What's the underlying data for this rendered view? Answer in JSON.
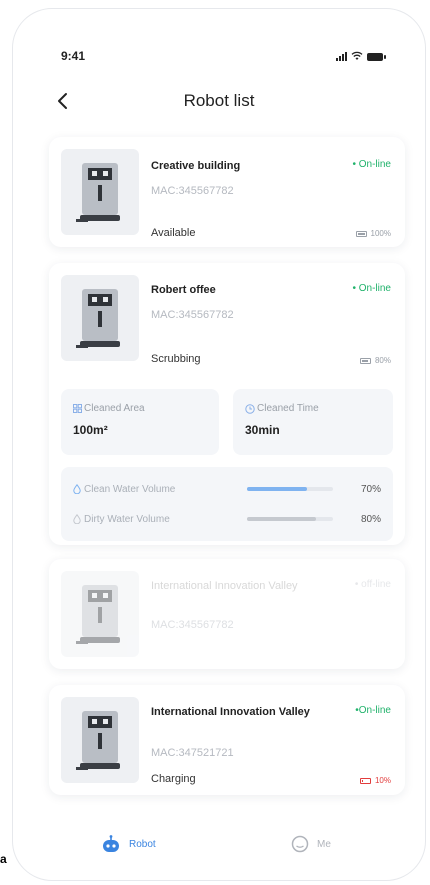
{
  "status": {
    "time": "9:41"
  },
  "nav": {
    "title": "Robot list"
  },
  "robots": [
    {
      "name": "Creative building",
      "mac": "MAC:345567782",
      "status": "On-line",
      "state": "Available",
      "battery": "100%",
      "battery_level": 1.0
    },
    {
      "name": "Robert offee",
      "mac": "MAC:345567782",
      "status": "On-line",
      "state": "Scrubbing",
      "battery": "80%",
      "battery_level": 0.8
    },
    {
      "name": "International Innovation Valley",
      "mac": "MAC:345567782",
      "status": "off-line",
      "state": ""
    },
    {
      "name": "International Innovation Valley",
      "mac": "MAC:347521721",
      "status": "On-line",
      "state": "Charging",
      "battery": "10%",
      "battery_level": 0.1
    }
  ],
  "details": {
    "cleaned_area_label": "Cleaned Area",
    "cleaned_area_value": "100m²",
    "cleaned_time_label": "Cleaned Time",
    "cleaned_time_value": "30min",
    "clean_water_label": "Clean Water Volume",
    "clean_water_pct": "70%",
    "clean_water_level": 0.7,
    "dirty_water_label": "Dirty Water Volume",
    "dirty_water_pct": "80%",
    "dirty_water_level": 0.8
  },
  "tabs": {
    "robot": "Robot",
    "me": "Me"
  },
  "footnote": "a",
  "colors": {
    "online": "#20b26b",
    "accent": "#3a84e0",
    "low_battery": "#e23c3c",
    "clean_water_bar": "#7fb3f0",
    "dirty_water_bar": "#c5c9cf"
  },
  "icons": {
    "back": "chevron-left-icon",
    "robot": "robot-icon",
    "me": "user-circle-icon",
    "area": "grid-icon",
    "time": "clock-icon",
    "clean_water": "water-drop-icon",
    "dirty_water": "water-drop-icon"
  }
}
